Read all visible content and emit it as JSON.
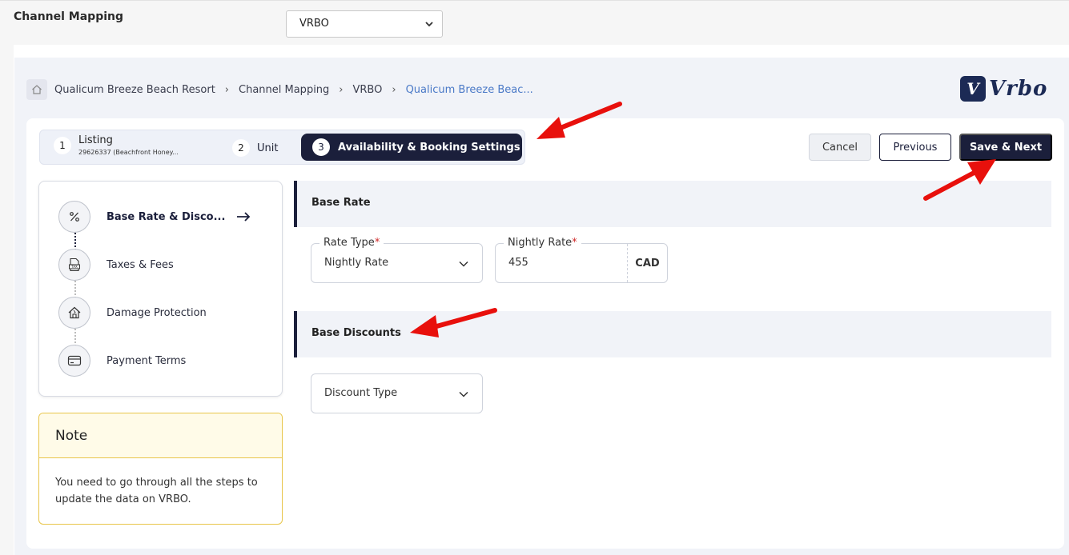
{
  "topbar": {
    "title": "Channel Mapping",
    "channel_value": "VRBO"
  },
  "breadcrumb": [
    "Qualicum Breeze Beach Resort",
    "Channel Mapping",
    "VRBO",
    "Qualicum Breeze Beac..."
  ],
  "logo": {
    "mark": "V",
    "word": "Vrbo"
  },
  "stepper": {
    "steps": [
      {
        "num": "1",
        "label": "Listing",
        "sub": "29626337 (Beachfront Honey..."
      },
      {
        "num": "2",
        "label": "Unit"
      },
      {
        "num": "3",
        "label": "Availability & Booking Settings"
      }
    ]
  },
  "actions": {
    "cancel": "Cancel",
    "previous": "Previous",
    "save_next": "Save & Next"
  },
  "sidenav": {
    "items": [
      {
        "label": "Base Rate & Disco...",
        "icon": "percent-icon"
      },
      {
        "label": "Taxes & Fees",
        "icon": "tax-icon"
      },
      {
        "label": "Damage Protection",
        "icon": "house-icon"
      },
      {
        "label": "Payment Terms",
        "icon": "card-icon"
      }
    ]
  },
  "note": {
    "title": "Note",
    "text": "You need to go through all the steps to update the data on VRBO."
  },
  "base_rate": {
    "title": "Base Rate",
    "rate_type": {
      "label": "Rate Type",
      "required": "*",
      "value": "Nightly Rate"
    },
    "nightly_rate": {
      "label": "Nightly Rate",
      "required": "*",
      "value": "455",
      "currency": "CAD"
    }
  },
  "base_discounts": {
    "title": "Base Discounts",
    "discount_type": {
      "placeholder": "Discount Type"
    }
  },
  "colors": {
    "primary": "#1b1f3b",
    "link": "#4a79c7",
    "note_border": "#e8c54a",
    "annotation": "#e8100c"
  }
}
